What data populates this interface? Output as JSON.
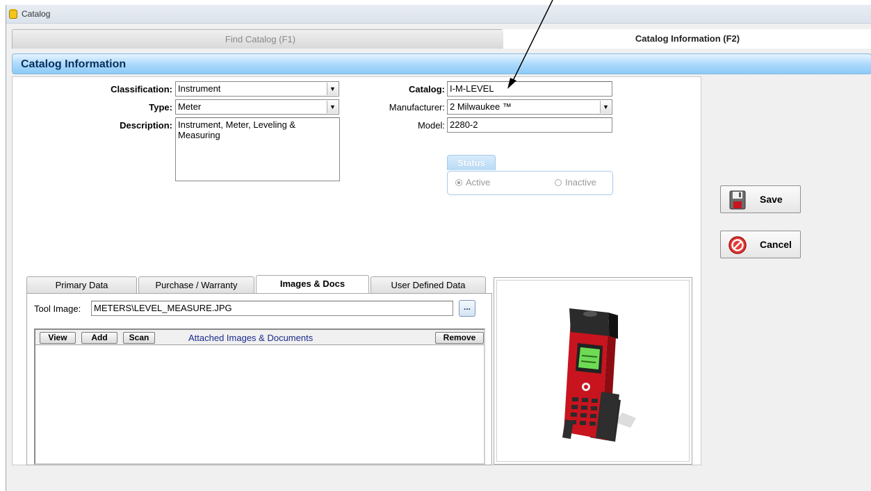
{
  "window": {
    "title": "Catalog"
  },
  "tabs": {
    "find": "Find Catalog (F1)",
    "info": "Catalog Information (F2)"
  },
  "section_title": "Catalog Information",
  "form": {
    "classification_label": "Classification:",
    "classification_value": "Instrument",
    "type_label": "Type:",
    "type_value": "Meter",
    "description_label": "Description:",
    "description_value": "Instrument, Meter, Leveling & Measuring",
    "catalog_label": "Catalog:",
    "catalog_value": "I-M-LEVEL",
    "manufacturer_label": "Manufacturer:",
    "manufacturer_value": "2 Milwaukee ™",
    "model_label": "Model:",
    "model_value": "2280-2",
    "status_label": "Status",
    "status_active": "Active",
    "status_inactive": "Inactive",
    "status_selected": "Active"
  },
  "buttons": {
    "save": "Save",
    "cancel": "Cancel"
  },
  "bottom_tabs": [
    "Primary Data",
    "Purchase / Warranty",
    "Images & Docs",
    "User Defined Data"
  ],
  "active_bottom_tab": "Images & Docs",
  "images_docs": {
    "tool_image_label": "Tool Image:",
    "tool_image_value": "METERS\\LEVEL_MEASURE.JPG",
    "browse_label": "...",
    "view_label": "View",
    "add_label": "Add",
    "scan_label": "Scan",
    "list_title": "Attached Images & Documents",
    "remove_label": "Remove"
  },
  "colors": {
    "header_blue": "#a9d8fb",
    "header_text": "#0a2f5c",
    "link_text": "#1a2a8c",
    "device_red": "#c8141e"
  },
  "icons": [
    "catalog-icon",
    "save-disk-icon",
    "cancel-circle-icon",
    "combo-arrow-icon",
    "annotation-arrow",
    "laser-meter-image"
  ]
}
